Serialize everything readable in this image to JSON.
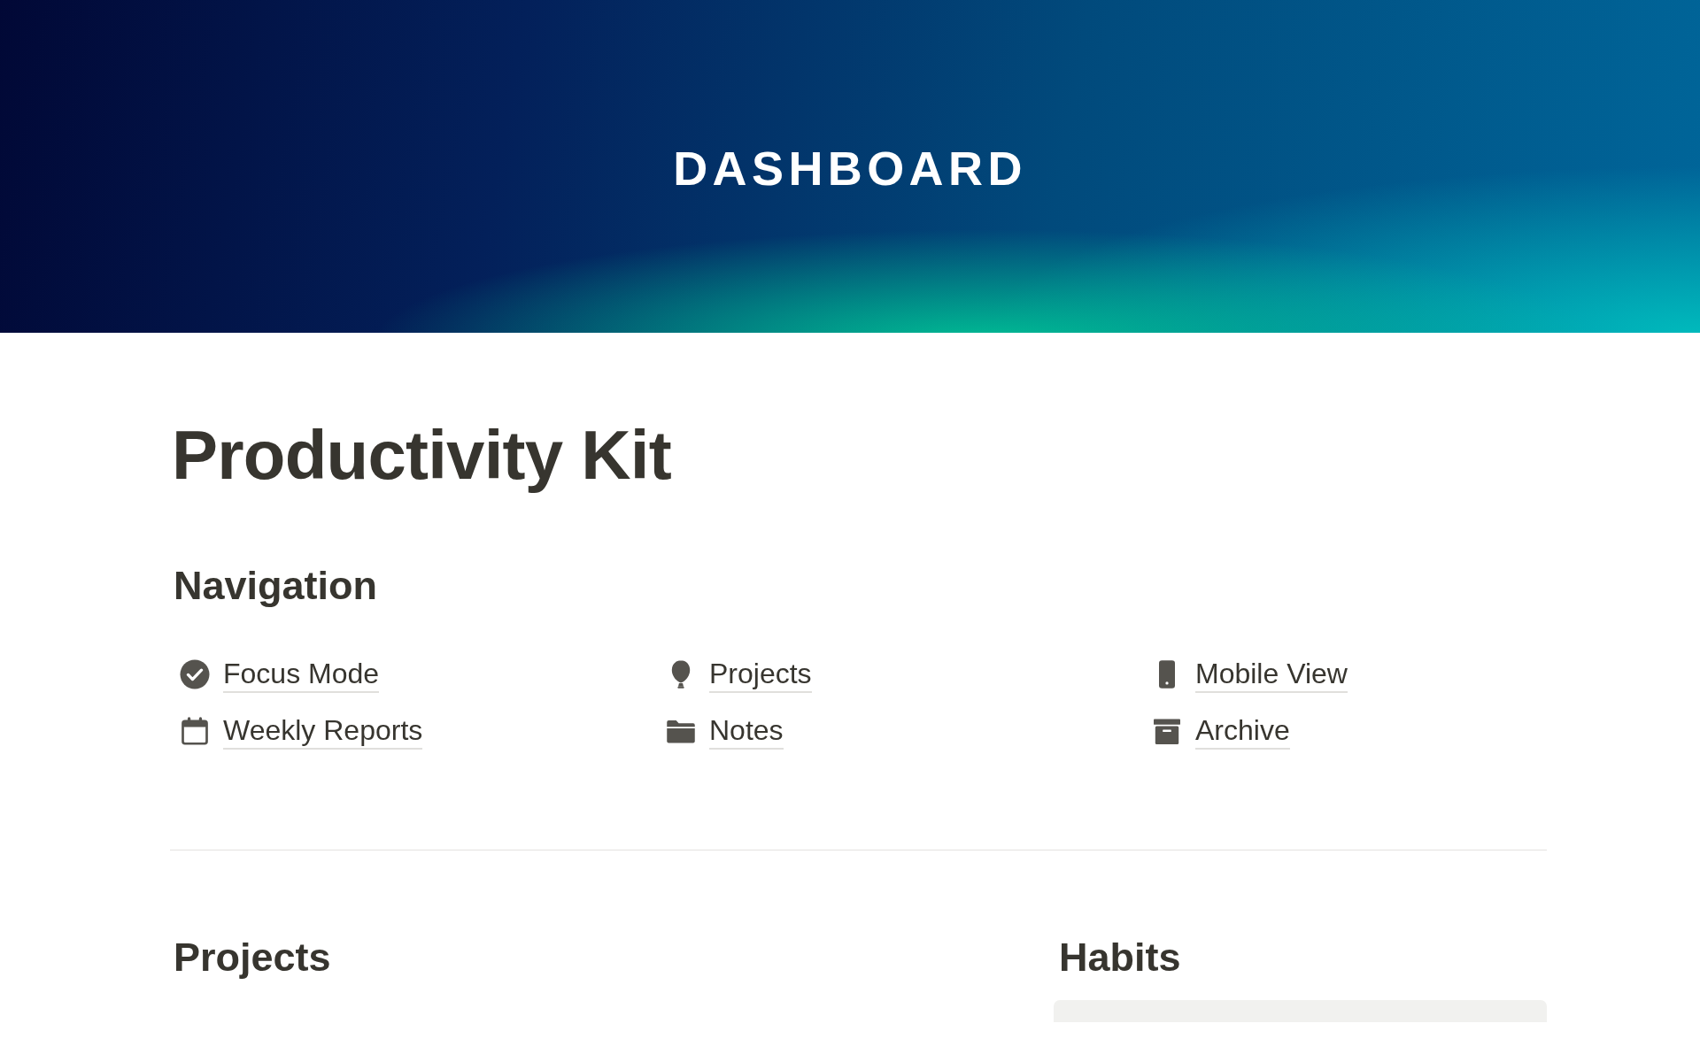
{
  "banner": {
    "title": "DASHBOARD"
  },
  "page_title": "Productivity Kit",
  "navigation": {
    "heading": "Navigation",
    "columns": [
      {
        "links": [
          {
            "label": "Focus Mode",
            "kind": "check"
          },
          {
            "label": "Weekly Reports",
            "kind": "calendar"
          }
        ]
      },
      {
        "links": [
          {
            "label": "Projects",
            "kind": "balloon"
          },
          {
            "label": "Notes",
            "kind": "folder"
          }
        ]
      },
      {
        "links": [
          {
            "label": "Mobile View",
            "kind": "phone"
          },
          {
            "label": "Archive",
            "kind": "archive"
          }
        ]
      }
    ]
  },
  "sections": [
    {
      "heading": "Projects",
      "kind": "plain"
    },
    {
      "heading": "Habits",
      "kind": "panel"
    }
  ]
}
